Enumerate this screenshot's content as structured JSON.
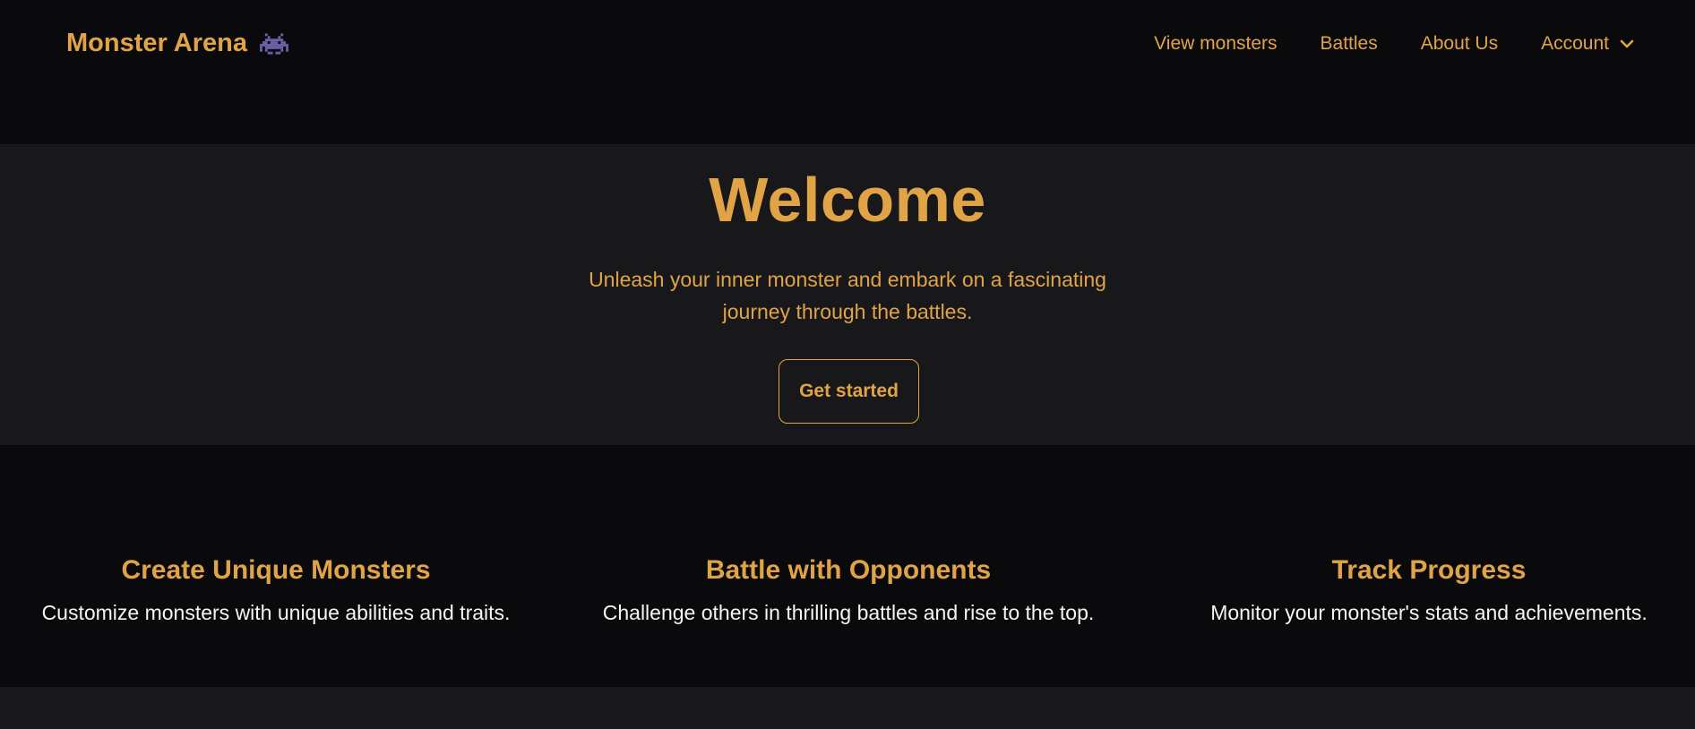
{
  "navbar": {
    "brand": "Monster Arena",
    "brand_icon": "space-invader-icon",
    "links": [
      {
        "label": "View monsters"
      },
      {
        "label": "Battles"
      },
      {
        "label": "About Us"
      },
      {
        "label": "Account",
        "icon": "chevron-down-icon"
      }
    ]
  },
  "hero": {
    "title": "Welcome",
    "subtitle": "Unleash your inner monster and embark on a fascinating journey through the battles.",
    "cta_label": "Get started"
  },
  "features": [
    {
      "title": "Create Unique Monsters",
      "description": "Customize monsters with unique abilities and traits."
    },
    {
      "title": "Battle with Opponents",
      "description": "Challenge others in thrilling battles and rise to the top."
    },
    {
      "title": "Track Progress",
      "description": "Monitor your monster's stats and achievements."
    }
  ],
  "colors": {
    "accent": "#e0a447",
    "background_dark": "#0a0a0d",
    "background": "#18181b",
    "text_light": "#f5f5f5",
    "icon_purple": "#6b5fa5"
  }
}
